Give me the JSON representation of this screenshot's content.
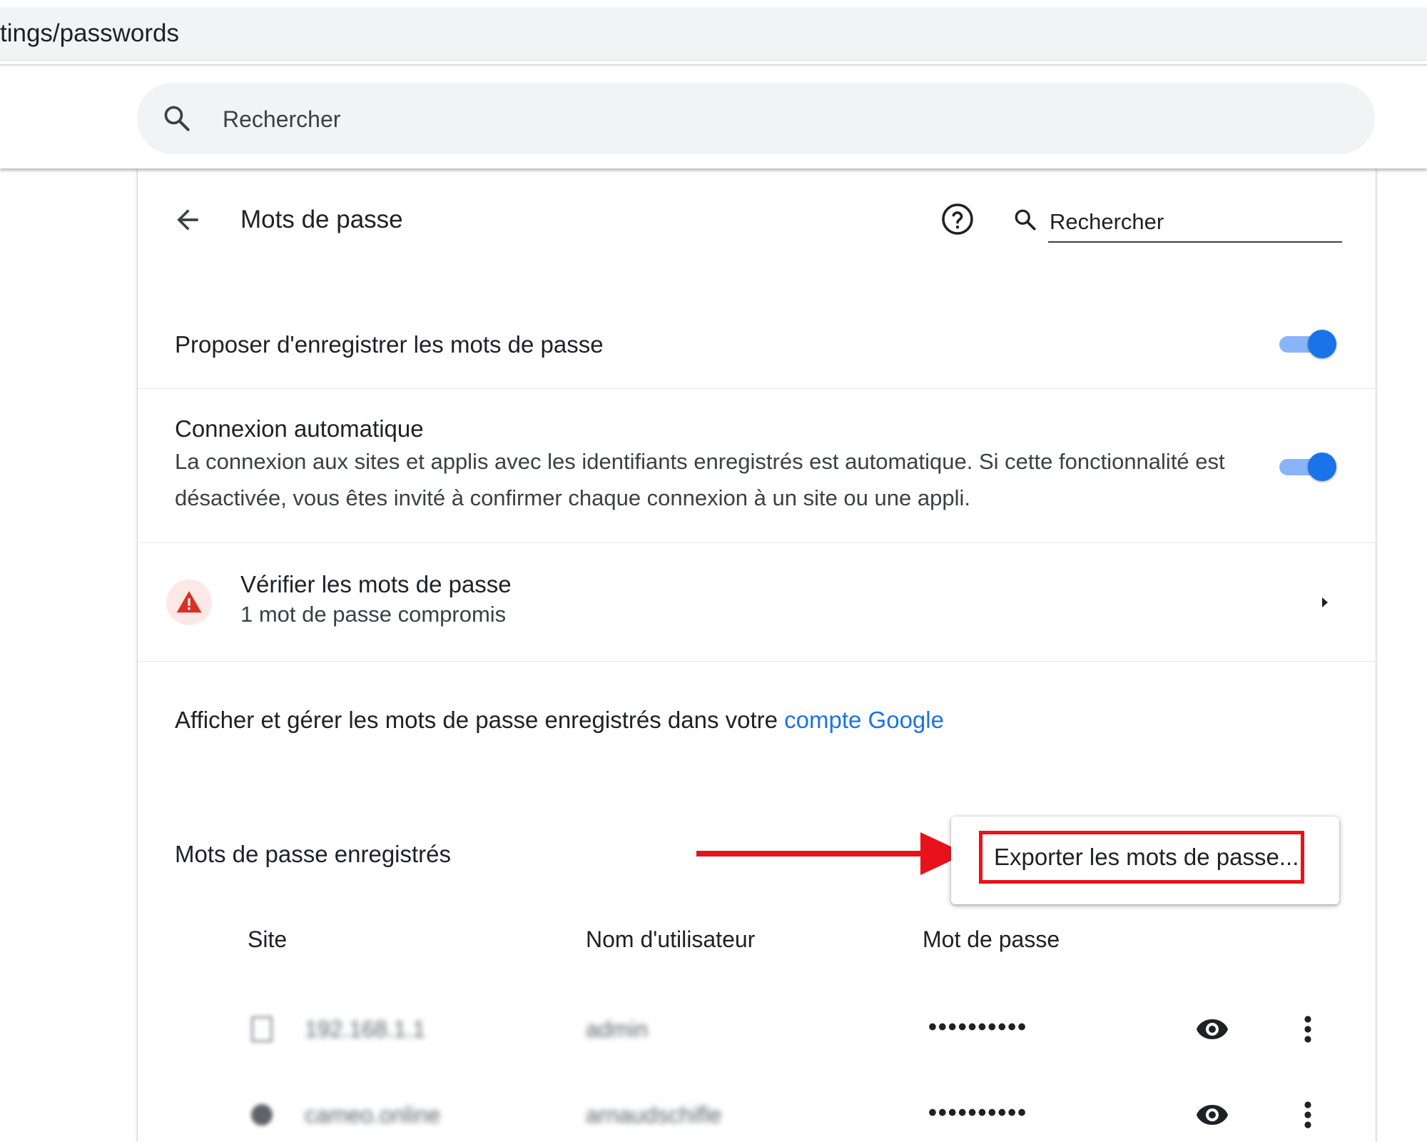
{
  "address": {
    "url": "tings/passwords"
  },
  "header": {
    "search_placeholder": "Rechercher"
  },
  "page": {
    "title": "Mots de passe",
    "search_placeholder": "Rechercher"
  },
  "settings": {
    "offer_save": {
      "label": "Proposer d'enregistrer les mots de passe",
      "enabled": true
    },
    "auto_signin": {
      "label": "Connexion automatique",
      "description": "La connexion aux sites et applis avec les identifiants enregistrés est automatique. Si cette fonctionnalité est désactivée, vous êtes invité à confirmer chaque connexion à un site ou une appli.",
      "enabled": true
    },
    "check": {
      "label": "Vérifier les mots de passe",
      "sub": "1 mot de passe compromis"
    },
    "manage": {
      "text": "Afficher et gérer les mots de passe enregistrés dans votre ",
      "link": "compte Google"
    }
  },
  "saved": {
    "title": "Mots de passe enregistrés",
    "menu": {
      "export_label": "Exporter les mots de passe..."
    },
    "columns": [
      "Site",
      "Nom d'utilisateur",
      "Mot de passe"
    ],
    "rows": [
      {
        "site": "192.168.1.1",
        "username": "admin",
        "password_mask": "••••••••••"
      },
      {
        "site": "cameo.online",
        "username": "arnaudschifle",
        "password_mask": "••••••••••"
      }
    ]
  },
  "colors": {
    "accent": "#1a73e8",
    "toggle_track": "#8ab4f8",
    "warning": "#d93025",
    "annotation": "#e8121b"
  }
}
